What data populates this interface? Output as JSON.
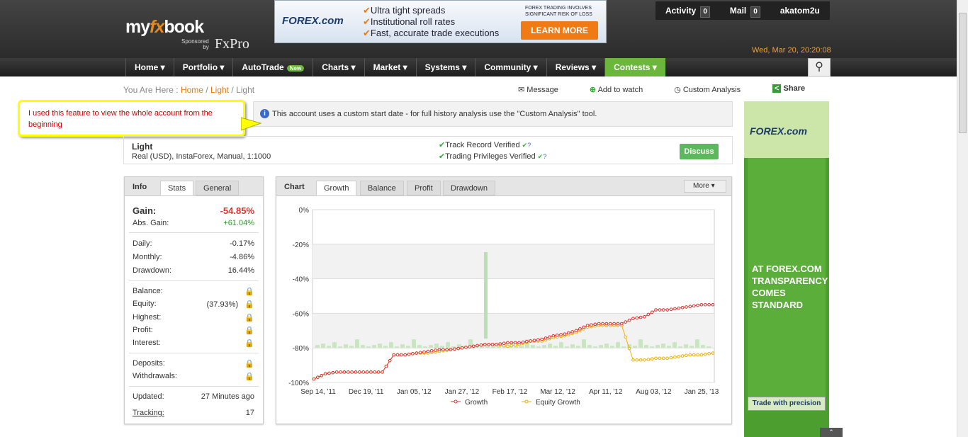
{
  "header": {
    "logo_pre": "my",
    "logo_mid": "fx",
    "logo_post": "book",
    "sponsored": "Sponsored",
    "by": "by",
    "fxpro": "FxPro",
    "date": "Wed, Mar 20, 20:20:08"
  },
  "topad": {
    "brand": "FOREX.com",
    "bullets": [
      "Ultra tight spreads",
      "Institutional roll rates",
      "Fast, accurate trade executions"
    ],
    "risk": "FOREX TRADING INVOLVES SIGNIFICANT RISK OF LOSS",
    "cta": "LEARN MORE"
  },
  "user": {
    "activity": "Activity",
    "activity_count": "0",
    "mail": "Mail",
    "mail_count": "0",
    "username": "akatom2u"
  },
  "nav": {
    "items": [
      "Home",
      "Portfolio",
      "AutoTrade",
      "Charts",
      "Market",
      "Systems",
      "Community",
      "Reviews",
      "Contests"
    ],
    "new_badge": "New"
  },
  "breadcrumb": {
    "prefix": "You Are Here :",
    "home": "Home",
    "sep": "/",
    "light": "Light",
    "current": "Light"
  },
  "actions": {
    "message": "Message",
    "watch": "Add to watch",
    "custom": "Custom Analysis",
    "share": "Share"
  },
  "info_msg": "This account uses a custom start date - for full history analysis use the \"Custom Analysis\" tool.",
  "callout": "I used this feature to view the whole account from the beginning",
  "account": {
    "name": "Light",
    "details": "Real (USD), InstaForex, Manual, 1:1000",
    "track": "Track Record Verified",
    "trading": "Trading Privileges Verified",
    "q": "?",
    "discuss": "Discuss"
  },
  "infopanel": {
    "title": "Info",
    "tab_stats": "Stats",
    "tab_general": "General",
    "gain_label": "Gain:",
    "gain": "-54.85%",
    "abs_label": "Abs. Gain:",
    "abs": "+61.04%",
    "daily_label": "Daily:",
    "daily": "-0.17%",
    "monthly_label": "Monthly:",
    "monthly": "-4.86%",
    "dd_label": "Drawdown:",
    "dd": "16.44%",
    "balance_label": "Balance:",
    "equity_label": "Equity:",
    "equity_pct": "(37.93%)",
    "highest_label": "Highest:",
    "profit_label": "Profit:",
    "interest_label": "Interest:",
    "deposits_label": "Deposits:",
    "withdrawals_label": "Withdrawals:",
    "updated_label": "Updated:",
    "updated": "27 Minutes ago",
    "tracking_label": "Tracking:",
    "tracking": "17"
  },
  "chartpanel": {
    "title": "Chart",
    "tabs": [
      "Growth",
      "Balance",
      "Profit",
      "Drawdown"
    ],
    "more": "More"
  },
  "chart_data": {
    "type": "line",
    "x_ticks": [
      "Sep 14, '11",
      "Dec 19, '11",
      "Jan 05, '12",
      "Jan 27, '12",
      "Feb 17, '12",
      "Mar 12, '12",
      "Apr 11, '12",
      "Aug 03, '12",
      "Jan 25, '13"
    ],
    "y_ticks": [
      "0%",
      "-20%",
      "-40%",
      "-60%",
      "-80%",
      "-100%"
    ],
    "ylim": [
      -100,
      0
    ],
    "series": [
      {
        "name": "Growth",
        "color": "#e03030",
        "values": [
          -98,
          -95,
          -94,
          -94,
          -94,
          -94,
          -94,
          -84,
          -84,
          -83,
          -82,
          -81,
          -81,
          -80,
          -79,
          -78,
          -78,
          -77,
          -77,
          -76,
          -75,
          -73,
          -72,
          -70,
          -67,
          -66,
          -66,
          -66,
          -63,
          -62,
          -58,
          -58,
          -57,
          -56,
          -55,
          -55
        ]
      },
      {
        "name": "Equity Growth",
        "color": "#f0b000",
        "values": [
          -98,
          -95,
          -94,
          -94,
          -94,
          -94,
          -94,
          -84,
          -84,
          -83,
          -83,
          -82,
          -81,
          -80,
          -79,
          -78,
          -78,
          -79,
          -78,
          -76,
          -76,
          -74,
          -73,
          -71,
          -68,
          -67,
          -67,
          -67,
          -87,
          -87,
          -86,
          -86,
          -85,
          -84,
          -84,
          -83
        ]
      }
    ]
  },
  "side_ad": {
    "brand": "FOREX.com",
    "message": "AT FOREX.COM TRANSPARENCY COMES STANDARD",
    "cta": "Trade with precision"
  }
}
